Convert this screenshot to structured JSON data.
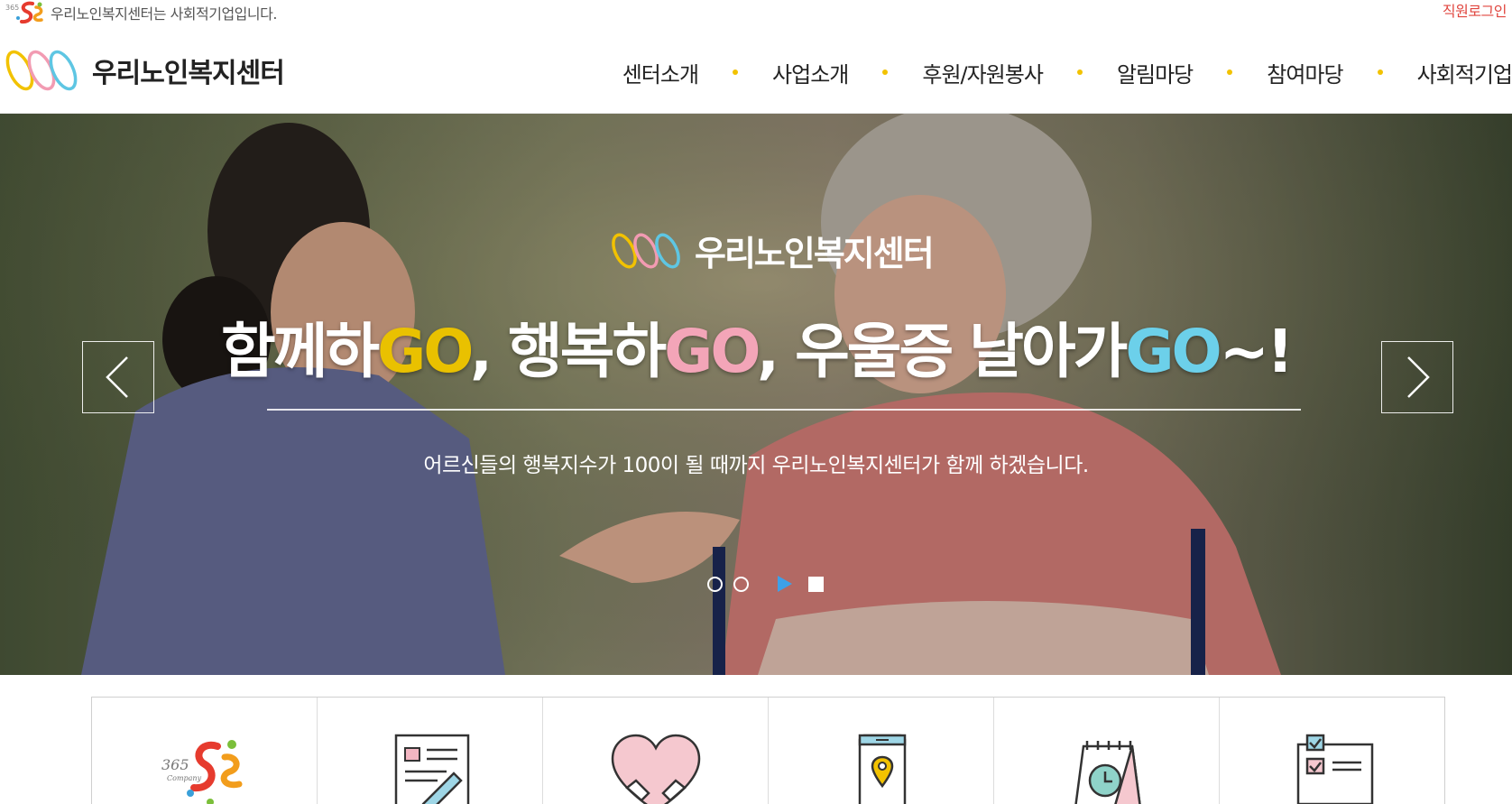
{
  "topbar": {
    "notice": "우리노인복지센터는 사회적기업입니다.",
    "staff_login": "직원로그인"
  },
  "header": {
    "brand_name": "우리노인복지센터",
    "nav": [
      "센터소개",
      "사업소개",
      "후원/자원봉사",
      "알림마당",
      "참여마당",
      "사회적기업"
    ]
  },
  "hero": {
    "logo_text": "우리노인복지센터",
    "headline": {
      "part1": "함께하",
      "go1": "GO",
      "part2": ", 행복하",
      "go2": "GO",
      "part3": ", 우울증 날아가",
      "go3": "GO",
      "part4": "~!"
    },
    "subline": "어르신들의 행복지수가 100이 될 때까지 우리노인복지센터가 함께 하겠습니다.",
    "slide_count": 2
  },
  "colors": {
    "accent_yellow": "#e9c100",
    "accent_pink": "#f3a5b8",
    "accent_cyan": "#6cd0ea",
    "login_red": "#e0463f",
    "nav_dot": "#f2c200"
  },
  "quick_menu": [
    {
      "icon": "social-enterprise-logo-icon"
    },
    {
      "icon": "document-pen-icon"
    },
    {
      "icon": "heart-hands-icon"
    },
    {
      "icon": "phone-location-icon"
    },
    {
      "icon": "calendar-clock-icon"
    },
    {
      "icon": "checklist-board-icon"
    }
  ]
}
